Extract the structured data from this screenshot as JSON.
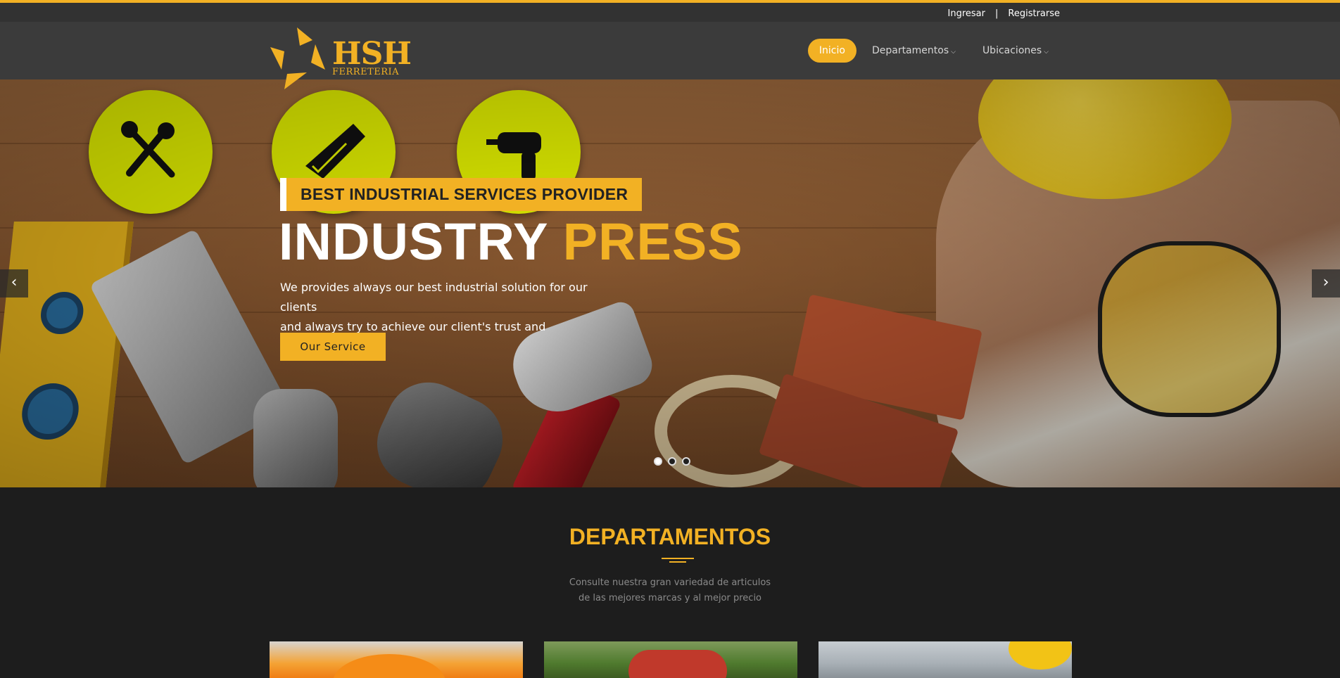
{
  "topbar": {
    "login": "Ingresar",
    "separator": "|",
    "register": "Registrarse"
  },
  "brand": {
    "name": "HSH",
    "subtitle": "FERRETERIA"
  },
  "nav": {
    "items": [
      {
        "label": "Inicio",
        "active": true
      },
      {
        "label": "Departamentos",
        "dropdown": true
      },
      {
        "label": "Ubicaciones",
        "dropdown": true
      }
    ]
  },
  "hero": {
    "tagline": "BEST INDUSTRIAL SERVICES PROVIDER",
    "headline_main": "INDUSTRY",
    "headline_accent": "PRESS",
    "description_line1": "We provides always our best industrial solution for our clients",
    "description_line2": "and always try to achieve our client's trust and satisfaction.",
    "cta_label": "Our Service",
    "slides_count": 3,
    "active_slide": 1,
    "prev_icon": "chevron-left-icon",
    "next_icon": "chevron-right-icon"
  },
  "departments": {
    "title": "DEPARTAMENTOS",
    "description_line1": "Consulte nuestra gran variedad de articulos",
    "description_line2": "de las mejores marcas y al mejor precio"
  },
  "colors": {
    "accent": "#f2b124",
    "topbar_bg": "#323232",
    "header_bg": "#3b3b3b",
    "page_bg": "#1d1d1d",
    "badge": "#e7f500"
  }
}
